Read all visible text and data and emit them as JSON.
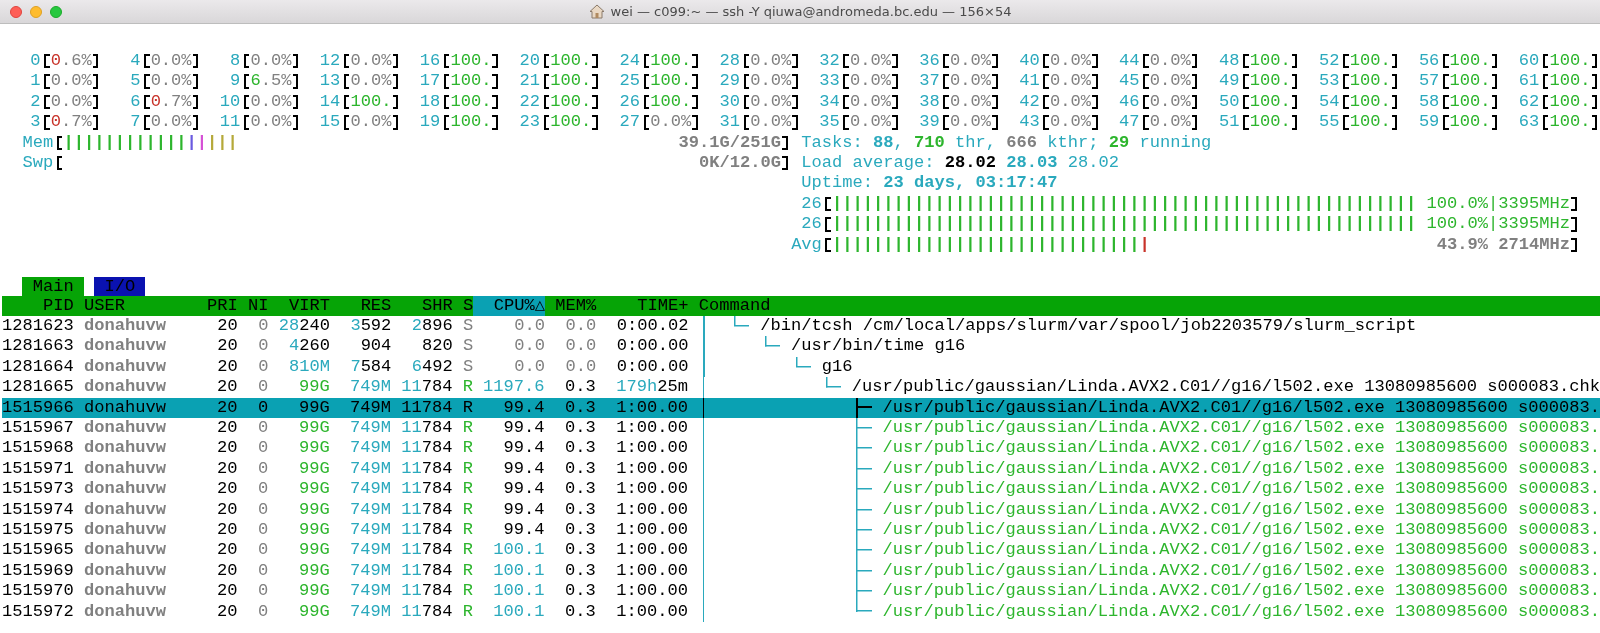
{
  "window": {
    "title": "wei — c099:~ — ssh -Y qiuwa@andromeda.bc.edu — 156×54"
  },
  "cpus": [
    {
      "label": "0",
      "reading": "0.6%",
      "level": 0.25,
      "color": "#c8332a"
    },
    {
      "label": "1",
      "reading": "0.0%"
    },
    {
      "label": "2",
      "reading": "0.0%"
    },
    {
      "label": "3",
      "reading": "0.7%",
      "level": 0.25,
      "color": "#c8332a"
    },
    {
      "label": "4",
      "reading": "0.0%"
    },
    {
      "label": "5",
      "reading": "0.0%"
    },
    {
      "label": "6",
      "reading": "0.7%",
      "level": 0.25,
      "color": "#c8332a"
    },
    {
      "label": "7",
      "reading": "0.0%"
    },
    {
      "label": "8",
      "reading": "0.0%"
    },
    {
      "label": "9",
      "reading": "6.5%",
      "level": 0.25,
      "color": "#2db52d"
    },
    {
      "label": "10",
      "reading": "0.0%"
    },
    {
      "label": "11",
      "reading": "0.0%"
    },
    {
      "label": "12",
      "reading": "0.0%"
    },
    {
      "label": "13",
      "reading": "0.0%"
    },
    {
      "label": "14",
      "reading": "100.",
      "level": 1,
      "color": "#2db52d"
    },
    {
      "label": "15",
      "reading": "0.0%"
    },
    {
      "label": "16",
      "reading": "100.",
      "level": 1,
      "color": "#2db52d"
    },
    {
      "label": "17",
      "reading": "100.",
      "level": 1,
      "color": "#2db52d"
    },
    {
      "label": "18",
      "reading": "100.",
      "level": 1,
      "color": "#2db52d"
    },
    {
      "label": "19",
      "reading": "100.",
      "level": 1,
      "color": "#2db52d"
    },
    {
      "label": "20",
      "reading": "100.",
      "level": 1,
      "color": "#2db52d"
    },
    {
      "label": "21",
      "reading": "100.",
      "level": 1,
      "color": "#2db52d"
    },
    {
      "label": "22",
      "reading": "100.",
      "level": 1,
      "color": "#2db52d"
    },
    {
      "label": "23",
      "reading": "100.",
      "level": 1,
      "color": "#2db52d"
    },
    {
      "label": "24",
      "reading": "100.",
      "level": 1,
      "color": "#2db52d"
    },
    {
      "label": "25",
      "reading": "100.",
      "level": 1,
      "color": "#2db52d"
    },
    {
      "label": "26",
      "reading": "100.",
      "level": 1,
      "color": "#2db52d"
    },
    {
      "label": "27",
      "reading": "0.0%"
    },
    {
      "label": "28",
      "reading": "0.0%"
    },
    {
      "label": "29",
      "reading": "0.0%"
    },
    {
      "label": "30",
      "reading": "0.0%"
    },
    {
      "label": "31",
      "reading": "0.0%"
    },
    {
      "label": "32",
      "reading": "0.0%"
    },
    {
      "label": "33",
      "reading": "0.0%"
    },
    {
      "label": "34",
      "reading": "0.0%"
    },
    {
      "label": "35",
      "reading": "0.0%"
    },
    {
      "label": "36",
      "reading": "0.0%"
    },
    {
      "label": "37",
      "reading": "0.0%"
    },
    {
      "label": "38",
      "reading": "0.0%"
    },
    {
      "label": "39",
      "reading": "0.0%"
    },
    {
      "label": "40",
      "reading": "0.0%"
    },
    {
      "label": "41",
      "reading": "0.0%"
    },
    {
      "label": "42",
      "reading": "0.0%"
    },
    {
      "label": "43",
      "reading": "0.0%"
    },
    {
      "label": "44",
      "reading": "0.0%"
    },
    {
      "label": "45",
      "reading": "0.0%"
    },
    {
      "label": "46",
      "reading": "0.0%"
    },
    {
      "label": "47",
      "reading": "0.0%"
    },
    {
      "label": "48",
      "reading": "100.",
      "level": 1,
      "color": "#2db52d"
    },
    {
      "label": "49",
      "reading": "100.",
      "level": 1,
      "color": "#2db52d"
    },
    {
      "label": "50",
      "reading": "100.",
      "level": 1,
      "color": "#2db52d"
    },
    {
      "label": "51",
      "reading": "100.",
      "level": 1,
      "color": "#2db52d"
    },
    {
      "label": "52",
      "reading": "100.",
      "level": 1,
      "color": "#2db52d"
    },
    {
      "label": "53",
      "reading": "100.",
      "level": 1,
      "color": "#2db52d"
    },
    {
      "label": "54",
      "reading": "100.",
      "level": 1,
      "color": "#2db52d"
    },
    {
      "label": "55",
      "reading": "100.",
      "level": 1,
      "color": "#2db52d"
    },
    {
      "label": "56",
      "reading": "100.",
      "level": 1,
      "color": "#2db52d"
    },
    {
      "label": "57",
      "reading": "100.",
      "level": 1,
      "color": "#2db52d"
    },
    {
      "label": "58",
      "reading": "100.",
      "level": 1,
      "color": "#2db52d"
    },
    {
      "label": "59",
      "reading": "100.",
      "level": 1,
      "color": "#2db52d"
    },
    {
      "label": "60",
      "reading": "100.",
      "level": 1,
      "color": "#2db52d"
    },
    {
      "label": "61",
      "reading": "100.",
      "level": 1,
      "color": "#2db52d"
    },
    {
      "label": "62",
      "reading": "100.",
      "level": 1,
      "color": "#2db52d"
    },
    {
      "label": "63",
      "reading": "100.",
      "level": 1,
      "color": "#2db52d"
    }
  ],
  "left_meters": [
    {
      "label": "Mem",
      "kind": "memory",
      "reading": "39.1G/251G",
      "segments": [
        {
          "text": "||||||||||||",
          "color": "#2db52d"
        },
        {
          "text": "|",
          "color": "#6a5ae0"
        },
        {
          "text": "|",
          "color": "#d54fd5"
        },
        {
          "text": "|||",
          "color": "#b5a93a"
        }
      ]
    },
    {
      "label": "Swp",
      "kind": "memory",
      "reading": "0K/12.0G"
    }
  ],
  "tasks": {
    "parts": [
      {
        "text": "Tasks: ",
        "kind": "label"
      },
      {
        "text": "88",
        "kind": "count"
      },
      {
        "text": ", ",
        "kind": "label"
      },
      {
        "text": "710",
        "kind": "threads"
      },
      {
        "text": " thr, ",
        "kind": "label"
      },
      {
        "text": "666",
        "kind": "kthreads"
      },
      {
        "text": " kthr; ",
        "kind": "label"
      },
      {
        "text": "29",
        "kind": "running"
      },
      {
        "text": " running",
        "kind": "label"
      }
    ]
  },
  "load_average": {
    "parts": [
      {
        "text": "Load average: ",
        "kind": "label"
      },
      {
        "text": "28.02",
        "kind": "load1"
      },
      {
        "text": " 28.03",
        "kind": "load5"
      },
      {
        "text": " 28.02",
        "kind": "load15"
      }
    ]
  },
  "uptime": {
    "parts": [
      {
        "text": "Uptime: ",
        "kind": "label"
      },
      {
        "text": "23 days, 03:17:47",
        "kind": "count"
      }
    ]
  },
  "core_meters": [
    {
      "label": "26",
      "kind": "core",
      "reading": "100.0%|3395MHz",
      "segments": [
        {
          "text": "|||||||||||||||||||||||||||||||||||||||||||||||||||||||||",
          "color": "#2db52d"
        }
      ]
    },
    {
      "label": "26",
      "kind": "core",
      "reading": "100.0%|3395MHz",
      "segments": [
        {
          "text": "|||||||||||||||||||||||||||||||||||||||||||||||||||||||||",
          "color": "#2db52d"
        }
      ]
    },
    {
      "label": "Avg",
      "kind": "average",
      "reading": "43.9% 2714MHz",
      "segments": [
        {
          "text": "||||||||||||||||||||||||||||||",
          "color": "#2db52d"
        },
        {
          "text": "|",
          "color": "#c8332a"
        }
      ]
    }
  ],
  "tabs": [
    {
      "label": "Main",
      "selected": true
    },
    {
      "label": "I/O",
      "selected": false
    }
  ],
  "columns": [
    {
      "label": "PID",
      "selected": false
    },
    {
      "label": "USER",
      "selected": false
    },
    {
      "label": "PRI",
      "selected": false
    },
    {
      "label": "NI",
      "selected": false
    },
    {
      "label": "VIRT",
      "selected": false
    },
    {
      "label": "RES",
      "selected": false
    },
    {
      "label": "SHR",
      "selected": false
    },
    {
      "label": "S",
      "selected": false
    },
    {
      "label": "CPU%△",
      "selected": true
    },
    {
      "label": "MEM%",
      "selected": false
    },
    {
      "label": "TIME+",
      "selected": false
    },
    {
      "label": "Command",
      "selected": false
    }
  ],
  "processes": [
    {
      "pid": "1281623",
      "user": "donahuvw",
      "pri": "20",
      "ni": "0",
      "virt": "28240",
      "res": "3592",
      "shr": "2896",
      "state": "S",
      "running": false,
      "cpu": "0.0",
      "mem": "0.0",
      "time": "0:00.02",
      "command": "/bin/tcsh /cm/local/apps/slurm/var/spool/job2203579/slurm_script",
      "kind": "process",
      "selected": false,
      "children": [
        {
          "pid": "1281663",
          "user": "donahuvw",
          "pri": "20",
          "ni": "0",
          "virt": "4260",
          "res": "904",
          "shr": "820",
          "state": "S",
          "running": false,
          "cpu": "0.0",
          "mem": "0.0",
          "time": "0:00.00",
          "command": "/usr/bin/time g16",
          "kind": "process",
          "selected": false,
          "children": [
            {
              "pid": "1281664",
              "user": "donahuvw",
              "pri": "20",
              "ni": "0",
              "virt": "810M",
              "res": "7584",
              "shr": "6492",
              "state": "S",
              "running": false,
              "cpu": "0.0",
              "mem": "0.0",
              "time": "0:00.00",
              "command": "g16",
              "kind": "process",
              "selected": false,
              "children": [
                {
                  "pid": "1281665",
                  "user": "donahuvw",
                  "pri": "20",
                  "ni": "0",
                  "virt": "99G",
                  "res": "749M",
                  "shr": "11784",
                  "state": "R",
                  "running": true,
                  "cpu": "1197.6",
                  "mem": "0.3",
                  "time": "179h25m",
                  "command": "/usr/public/gaussian/Linda.AVX2.C01//g16/l502.exe 13080985600 s000083.chk",
                  "kind": "process",
                  "selected": false,
                  "children": [
                    {
                      "pid": "1515966",
                      "user": "donahuvw",
                      "pri": "20",
                      "ni": "0",
                      "virt": "99G",
                      "res": "749M",
                      "shr": "11784",
                      "state": "R",
                      "running": true,
                      "cpu": "99.4",
                      "mem": "0.3",
                      "time": "1:00.00",
                      "command": "/usr/public/gaussian/Linda.AVX2.C01//g16/l502.exe 13080985600 s000083.",
                      "kind": "thread",
                      "selected": true
                    },
                    {
                      "pid": "1515967",
                      "user": "donahuvw",
                      "pri": "20",
                      "ni": "0",
                      "virt": "99G",
                      "res": "749M",
                      "shr": "11784",
                      "state": "R",
                      "running": true,
                      "cpu": "99.4",
                      "mem": "0.3",
                      "time": "1:00.00",
                      "command": "/usr/public/gaussian/Linda.AVX2.C01//g16/l502.exe 13080985600 s000083.",
                      "kind": "thread",
                      "selected": false
                    },
                    {
                      "pid": "1515968",
                      "user": "donahuvw",
                      "pri": "20",
                      "ni": "0",
                      "virt": "99G",
                      "res": "749M",
                      "shr": "11784",
                      "state": "R",
                      "running": true,
                      "cpu": "99.4",
                      "mem": "0.3",
                      "time": "1:00.00",
                      "command": "/usr/public/gaussian/Linda.AVX2.C01//g16/l502.exe 13080985600 s000083.",
                      "kind": "thread",
                      "selected": false
                    },
                    {
                      "pid": "1515971",
                      "user": "donahuvw",
                      "pri": "20",
                      "ni": "0",
                      "virt": "99G",
                      "res": "749M",
                      "shr": "11784",
                      "state": "R",
                      "running": true,
                      "cpu": "99.4",
                      "mem": "0.3",
                      "time": "1:00.00",
                      "command": "/usr/public/gaussian/Linda.AVX2.C01//g16/l502.exe 13080985600 s000083.",
                      "kind": "thread",
                      "selected": false
                    },
                    {
                      "pid": "1515973",
                      "user": "donahuvw",
                      "pri": "20",
                      "ni": "0",
                      "virt": "99G",
                      "res": "749M",
                      "shr": "11784",
                      "state": "R",
                      "running": true,
                      "cpu": "99.4",
                      "mem": "0.3",
                      "time": "1:00.00",
                      "command": "/usr/public/gaussian/Linda.AVX2.C01//g16/l502.exe 13080985600 s000083.",
                      "kind": "thread",
                      "selected": false
                    },
                    {
                      "pid": "1515974",
                      "user": "donahuvw",
                      "pri": "20",
                      "ni": "0",
                      "virt": "99G",
                      "res": "749M",
                      "shr": "11784",
                      "state": "R",
                      "running": true,
                      "cpu": "99.4",
                      "mem": "0.3",
                      "time": "1:00.00",
                      "command": "/usr/public/gaussian/Linda.AVX2.C01//g16/l502.exe 13080985600 s000083.",
                      "kind": "thread",
                      "selected": false
                    },
                    {
                      "pid": "1515975",
                      "user": "donahuvw",
                      "pri": "20",
                      "ni": "0",
                      "virt": "99G",
                      "res": "749M",
                      "shr": "11784",
                      "state": "R",
                      "running": true,
                      "cpu": "99.4",
                      "mem": "0.3",
                      "time": "1:00.00",
                      "command": "/usr/public/gaussian/Linda.AVX2.C01//g16/l502.exe 13080985600 s000083.",
                      "kind": "thread",
                      "selected": false
                    },
                    {
                      "pid": "1515965",
                      "user": "donahuvw",
                      "pri": "20",
                      "ni": "0",
                      "virt": "99G",
                      "res": "749M",
                      "shr": "11784",
                      "state": "R",
                      "running": true,
                      "cpu": "100.1",
                      "mem": "0.3",
                      "time": "1:00.00",
                      "command": "/usr/public/gaussian/Linda.AVX2.C01//g16/l502.exe 13080985600 s000083.",
                      "kind": "thread",
                      "selected": false
                    },
                    {
                      "pid": "1515969",
                      "user": "donahuvw",
                      "pri": "20",
                      "ni": "0",
                      "virt": "99G",
                      "res": "749M",
                      "shr": "11784",
                      "state": "R",
                      "running": true,
                      "cpu": "100.1",
                      "mem": "0.3",
                      "time": "1:00.00",
                      "command": "/usr/public/gaussian/Linda.AVX2.C01//g16/l502.exe 13080985600 s000083.",
                      "kind": "thread",
                      "selected": false
                    },
                    {
                      "pid": "1515970",
                      "user": "donahuvw",
                      "pri": "20",
                      "ni": "0",
                      "virt": "99G",
                      "res": "749M",
                      "shr": "11784",
                      "state": "R",
                      "running": true,
                      "cpu": "100.1",
                      "mem": "0.3",
                      "time": "1:00.00",
                      "command": "/usr/public/gaussian/Linda.AVX2.C01//g16/l502.exe 13080985600 s000083.",
                      "kind": "thread",
                      "selected": false
                    },
                    {
                      "pid": "1515972",
                      "user": "donahuvw",
                      "pri": "20",
                      "ni": "0",
                      "virt": "99G",
                      "res": "749M",
                      "shr": "11784",
                      "state": "R",
                      "running": true,
                      "cpu": "100.1",
                      "mem": "0.3",
                      "time": "1:00.00",
                      "command": "/usr/public/gaussian/Linda.AVX2.C01//g16/l502.exe 13080985600 s000083.",
                      "kind": "thread",
                      "selected": false
                    }
                  ]
                }
              ]
            }
          ]
        }
      ]
    }
  ]
}
